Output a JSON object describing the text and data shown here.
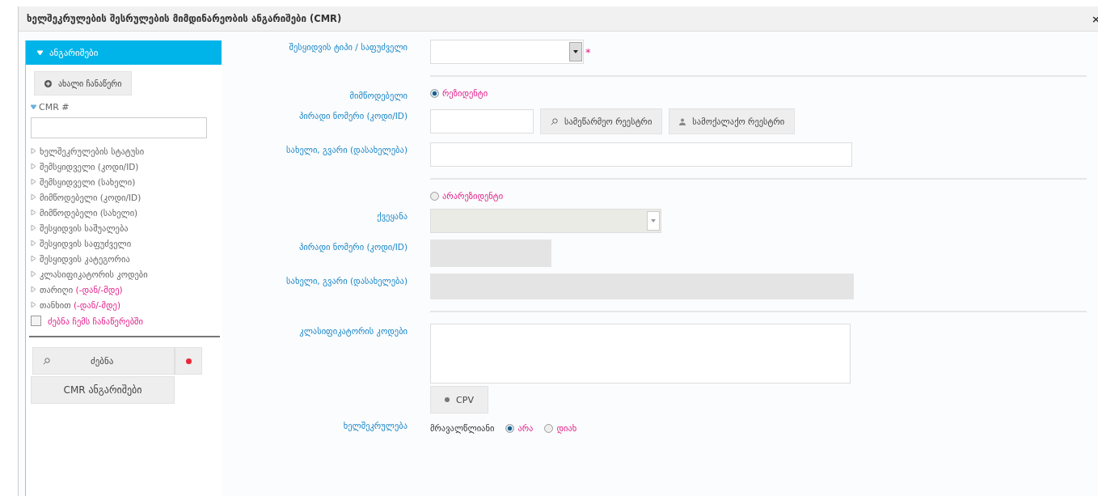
{
  "window": {
    "title": "ხელშეკრულების შესრულების მიმდინარეობის ანგარიშები (CMR)",
    "close": "×"
  },
  "sidebar": {
    "header": "ანგარიშები",
    "new_button": "ახალი ჩანაწერი",
    "cmr_label": "CMR #",
    "filters": [
      {
        "label": "ხელშეკრულების სტატუსი"
      },
      {
        "label": "შემსყიდველი (კოდი/ID)"
      },
      {
        "label": "შემსყიდველი (სახელი)"
      },
      {
        "label": "მიმწოდებელი (კოდი/ID)"
      },
      {
        "label": "მიმწოდებელი (სახელი)"
      },
      {
        "label": "შესყიდვის საშუალება"
      },
      {
        "label": "შესყიდვის საფუძველი"
      },
      {
        "label": "შესყიდვის კატეგორია"
      },
      {
        "label": "კლასიფიკატორის კოდები"
      },
      {
        "label": "თარიღი",
        "range": "(-დან/-მდე)"
      },
      {
        "label": "თანხით",
        "range": "(-დან/-მდე)"
      }
    ],
    "my_records": {
      "label": "ძებნა ჩემს ჩანაწერებში",
      "checked": false
    },
    "search_button": "ძებნა",
    "cmr_button": "CMR ანგარიშები"
  },
  "form": {
    "procurement_type": {
      "label": "შესყიდვის ტიპი / საფუძველი",
      "required_mark": "*"
    },
    "supplier_label": "მიმწოდებელი",
    "resident": {
      "option": "რეზიდენტი",
      "selected": true,
      "id_label": "პირადი ნომერი (კოდი/ID)",
      "buttons": [
        "სამეწარმეო რეესტრი",
        "სამოქალაქო რეესტრი"
      ],
      "name_label": "სახელი, გვარი (დასახელება)"
    },
    "non_resident": {
      "option": "არარეზიდენტი",
      "selected": false,
      "country_label": "ქვეყანა",
      "id_label": "პირადი ნომერი (კოდი/ID)",
      "name_label": "სახელი, გვარი (დასახელება)"
    },
    "classifier": {
      "label": "კლასიფიკატორის კოდები",
      "button": "CPV"
    },
    "contract": {
      "label": "ხელშეკრულება",
      "multi_year_label": "მრავალწლიანი",
      "options": [
        {
          "label": "არა",
          "selected": true
        },
        {
          "label": "დიახ",
          "selected": false
        }
      ]
    }
  }
}
